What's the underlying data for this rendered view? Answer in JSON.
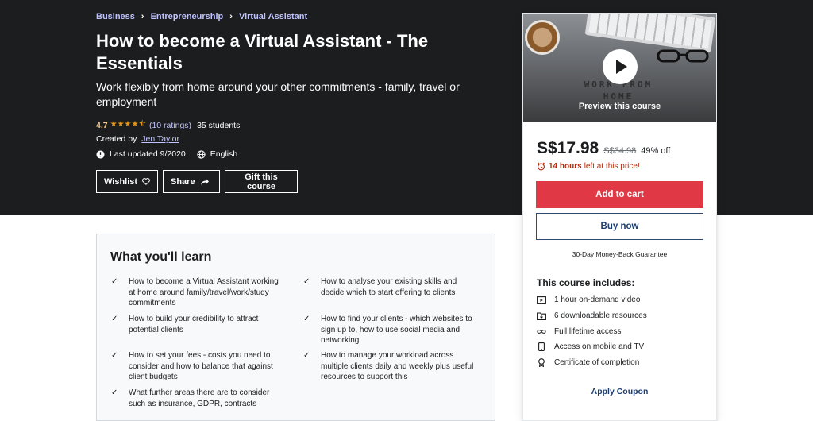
{
  "breadcrumb": [
    {
      "label": "Business"
    },
    {
      "label": "Entrepreneurship"
    },
    {
      "label": "Virtual Assistant"
    }
  ],
  "course": {
    "title": "How to become a Virtual Assistant - The Essentials",
    "subtitle": "Work flexibly from home around your other commitments - family, travel or employment",
    "rating": "4.7",
    "rating_value": 4.7,
    "rating_count": "(10 ratings)",
    "students": "35 students",
    "created_by_label": "Created by",
    "author": "Jen Taylor",
    "last_updated": "Last updated 9/2020",
    "language": "English"
  },
  "actions": {
    "wishlist": "Wishlist",
    "share": "Share",
    "gift": "Gift this course"
  },
  "learn": {
    "title": "What you'll learn",
    "items": [
      "How to become a Virtual Assistant working at home around family/travel/work/study commitments",
      "How to analyse your existing skills and decide which to start offering to clients",
      "How to build your credibility to attract potential clients",
      "How to find your clients - which websites to sign up to, how to use social media and networking",
      "How to set your fees - costs you need to consider and how to balance that against client budgets",
      "How to manage your workload across multiple clients daily and weekly plus useful resources to support this",
      "What further areas there are to consider such as insurance, GDPR, contracts"
    ]
  },
  "sidebar": {
    "preview_label": "Preview this course",
    "preview_image_text": "WORK FROM HOME",
    "price": "S$17.98",
    "old_price": "S$34.98",
    "discount": "49% off",
    "timer_hours": "14 hours",
    "timer_text": "left at this price!",
    "add_to_cart": "Add to cart",
    "buy_now": "Buy now",
    "guarantee": "30-Day Money-Back Guarantee",
    "includes_title": "This course includes:",
    "includes": [
      {
        "icon": "video-icon",
        "label": "1 hour on-demand video"
      },
      {
        "icon": "download-icon",
        "label": "6 downloadable resources"
      },
      {
        "icon": "infinity-icon",
        "label": "Full lifetime access"
      },
      {
        "icon": "mobile-icon",
        "label": "Access on mobile and TV"
      },
      {
        "icon": "certificate-icon",
        "label": "Certificate of completion"
      }
    ],
    "apply_coupon": "Apply Coupon"
  },
  "colors": {
    "hero_bg": "#1c1d1f",
    "link_purple": "#c0c4fc",
    "star": "#e59819",
    "rating_text": "#f3ca8c",
    "cart_red": "#e03844",
    "buy_border": "#2e4a73",
    "timer_red": "#b32d0f"
  }
}
